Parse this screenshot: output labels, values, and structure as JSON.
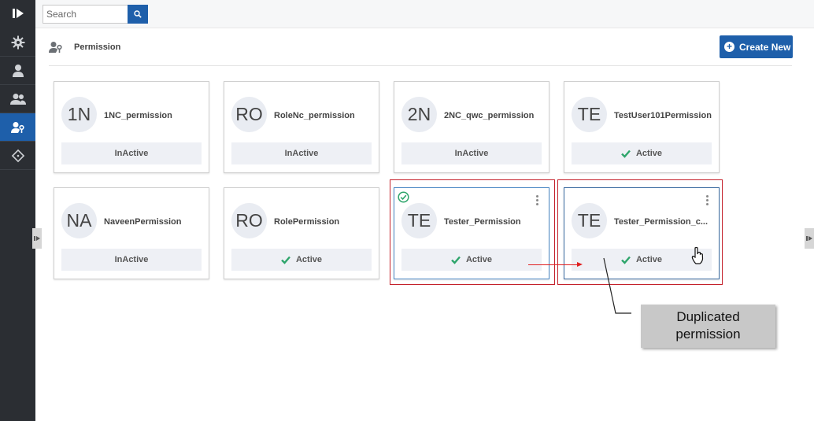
{
  "search": {
    "placeholder": "Search"
  },
  "header": {
    "title": "Permission",
    "create_label": "Create New"
  },
  "cards": [
    {
      "initials": "1N",
      "name": "1NC_permission",
      "status": "InActive"
    },
    {
      "initials": "RO",
      "name": "RoleNc_permission",
      "status": "InActive"
    },
    {
      "initials": "2N",
      "name": "2NC_qwc_permission",
      "status": "InActive"
    },
    {
      "initials": "TE",
      "name": "TestUser101Permission",
      "status": "Active"
    },
    {
      "initials": "NA",
      "name": "NaveenPermission",
      "status": "InActive"
    },
    {
      "initials": "RO",
      "name": "RolePermission",
      "status": "Active"
    },
    {
      "initials": "TE",
      "name": "Tester_Permission",
      "status": "Active"
    },
    {
      "initials": "TE",
      "name": "Tester_Permission_c...",
      "status": "Active"
    }
  ],
  "annotation": {
    "line1": "Duplicated",
    "line2": "permission"
  },
  "colors": {
    "sidebar": "#2b2e33",
    "accent": "#1e5faa",
    "active_check": "#2ea56b",
    "annotation_red": "#c4202a"
  },
  "icons": [
    "logo-icon",
    "settings-icon",
    "user-icon",
    "users-icon",
    "permission-icon",
    "tag-icon",
    "search-icon",
    "plus-icon",
    "check-icon",
    "kebab-menu-icon",
    "hand-cursor-icon"
  ]
}
